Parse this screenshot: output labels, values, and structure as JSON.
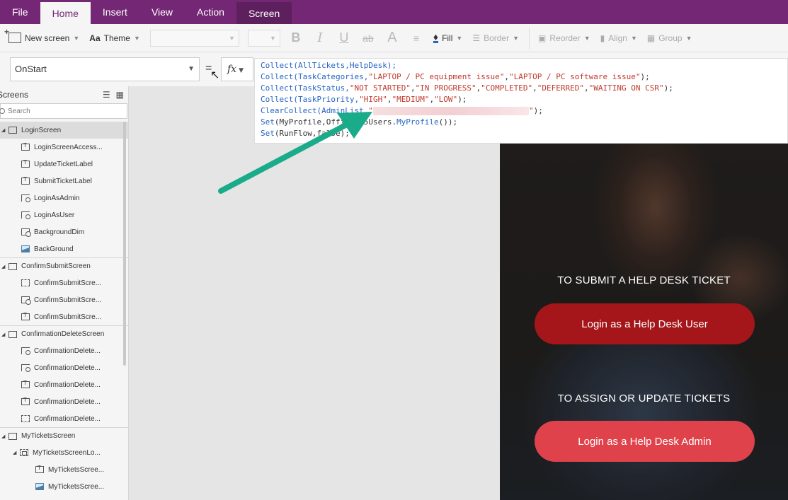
{
  "menu": {
    "tabs": [
      {
        "label": "File"
      },
      {
        "label": "Home"
      },
      {
        "label": "Insert"
      },
      {
        "label": "View"
      },
      {
        "label": "Action"
      },
      {
        "label": "Screen"
      }
    ]
  },
  "ribbon": {
    "new_screen": "New screen",
    "theme": "Theme",
    "bold": "B",
    "italic": "I",
    "underline": "U",
    "strikethrough": "ab",
    "font_size_glyph": "A",
    "fill": "Fill",
    "border": "Border",
    "reorder": "Reorder",
    "align": "Align",
    "group": "Group"
  },
  "formula_bar": {
    "property": "OnStart",
    "fx": "fx"
  },
  "formula": {
    "line1": {
      "fn": "Collect",
      "args": "(AllTickets,HelpDesk);"
    },
    "line2": {
      "fn": "Collect",
      "p1": "(TaskCategories,",
      "s1": "\"LAPTOP / PC equipment issue\"",
      "p2": ",",
      "s2": "\"LAPTOP / PC software issue\"",
      "p3": ");"
    },
    "line3": {
      "fn": "Collect",
      "p1": "(TaskStatus,",
      "s1": "\"NOT STARTED\"",
      "s2": "\"IN PROGRESS\"",
      "s3": "\"COMPLETED\"",
      "s4": "\"DEFERRED\"",
      "s5": "\"WAITING ON CSR\"",
      "p2": ");"
    },
    "line4": {
      "fn": "Collect",
      "p1": "(TaskPriority,",
      "s1": "\"HIGH\"",
      "s2": "\"MEDIUM\"",
      "s3": "\"LOW\"",
      "p2": ");"
    },
    "line5": {
      "fn": "ClearCollect",
      "p1": "(AdminList,",
      "s1": "\"",
      "s2": "\"",
      "p2": ");"
    },
    "line6": {
      "fn": "Set",
      "p1": "(MyProfile,Office365Users.",
      "fn2": "MyProfile",
      "p2": "());"
    },
    "line7": {
      "fn": "Set",
      "p1": "(RunFlow,false);"
    }
  },
  "tree": {
    "title": "Screens",
    "search_placeholder": "Search",
    "items": [
      {
        "label": "LoginScreen"
      },
      {
        "label": "LoginScreenAccess..."
      },
      {
        "label": "UpdateTicketLabel"
      },
      {
        "label": "SubmitTicketLabel"
      },
      {
        "label": "LoginAsAdmin"
      },
      {
        "label": "LoginAsUser"
      },
      {
        "label": "BackgroundDim"
      },
      {
        "label": "BackGround"
      },
      {
        "label": "ConfirmSubmitScreen"
      },
      {
        "label": "ConfirmSubmitScre..."
      },
      {
        "label": "ConfirmSubmitScre..."
      },
      {
        "label": "ConfirmSubmitScre..."
      },
      {
        "label": "ConfirmationDeleteScreen"
      },
      {
        "label": "ConfirmationDelete..."
      },
      {
        "label": "ConfirmationDelete..."
      },
      {
        "label": "ConfirmationDelete..."
      },
      {
        "label": "ConfirmationDelete..."
      },
      {
        "label": "ConfirmationDelete..."
      },
      {
        "label": "MyTicketsScreen"
      },
      {
        "label": "MyTicketsScreenLo..."
      },
      {
        "label": "MyTicketsScree..."
      },
      {
        "label": "MyTicketsScree..."
      }
    ]
  },
  "app": {
    "submit_label": "TO SUBMIT A HELP DESK TICKET",
    "user_button": "Login as a Help Desk User",
    "assign_label": "TO ASSIGN OR UPDATE TICKETS",
    "admin_button": "Login as a Help Desk Admin"
  },
  "colors": {
    "menubar": "#742774",
    "user_button": "#a4161a",
    "admin_button": "#e0424b",
    "arrow": "#1aab8a"
  }
}
